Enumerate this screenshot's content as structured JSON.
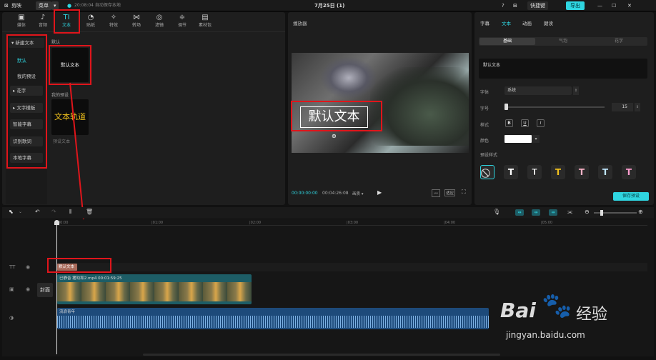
{
  "titlebar": {
    "app_name": "剪映",
    "menu": "菜单",
    "autosave": "20:08:04 自动保存本地",
    "date": "7月25日 (1)",
    "shortcut": "快捷键",
    "export": "导出"
  },
  "toolbar": [
    {
      "label": "媒体",
      "icon": "▣"
    },
    {
      "label": "音频",
      "icon": "♪"
    },
    {
      "label": "文本",
      "icon": "TI"
    },
    {
      "label": "贴纸",
      "icon": "◔"
    },
    {
      "label": "特效",
      "icon": "✧"
    },
    {
      "label": "转场",
      "icon": "⋈"
    },
    {
      "label": "滤镜",
      "icon": "◎"
    },
    {
      "label": "调节",
      "icon": "≑"
    },
    {
      "label": "素材包",
      "icon": "▤"
    }
  ],
  "sidebar": {
    "new_text": "▾ 新建文本",
    "items": [
      "默认",
      "我的预设"
    ],
    "buttons": [
      "▸ 花字",
      "▸ 文字模板",
      "智能字幕",
      "识别歌词",
      "本地字幕"
    ]
  },
  "library": {
    "section_default": "默认",
    "default_card": "默认文本",
    "section_mine": "我的预设",
    "mine_card": "文本轨道",
    "mine_caption": "预设文本"
  },
  "player": {
    "title": "播放器",
    "overlay_text": "默认文本",
    "current_time": "00:00:00:00",
    "total_time": "00:04:26:08",
    "quality": "画质 ▾",
    "ratio": "适应"
  },
  "inspector": {
    "tabs": [
      "字幕",
      "文本",
      "动画",
      "朗读"
    ],
    "subtabs": [
      "基础",
      "气泡",
      "花字"
    ],
    "text_value": "默认文本",
    "font_label": "字体",
    "font_value": "系统",
    "size_label": "字号",
    "size_value": "15",
    "style_label": "样式",
    "color_label": "颜色",
    "preset_label": "预设样式",
    "save_preset": "保存预设",
    "style_buttons": [
      "B",
      "U",
      "I"
    ],
    "presets": [
      {
        "glyph": "⃠",
        "color": "#cccccc"
      },
      {
        "glyph": "T",
        "color": "#ffffff"
      },
      {
        "glyph": "T",
        "color": "#ffffff"
      },
      {
        "glyph": "T",
        "color": "#f2c21d"
      },
      {
        "glyph": "T",
        "color": "#ffb3c8"
      },
      {
        "glyph": "T",
        "color": "#bfe6ff"
      },
      {
        "glyph": "T",
        "color": "#ff9ed0"
      }
    ]
  },
  "timeline": {
    "ticks": [
      "00:00",
      "|01:00",
      "|02:00",
      "|03:00",
      "|04:00",
      "|05:00"
    ],
    "text_clip": "默认文本",
    "cover": "封面",
    "video_clip_name": "已静音   猪劝和2.mp4    00:01:59:25",
    "audio_clip_name": "流浪青年"
  },
  "watermark": {
    "brand": "Bai",
    "brand2": "经验",
    "url": "jingyan.baidu.com"
  },
  "colors": {
    "accent": "#2fd5e0",
    "highlight_red": "#e0151b",
    "video_track": "#1d5d66",
    "audio_track": "#1d4a7a"
  }
}
